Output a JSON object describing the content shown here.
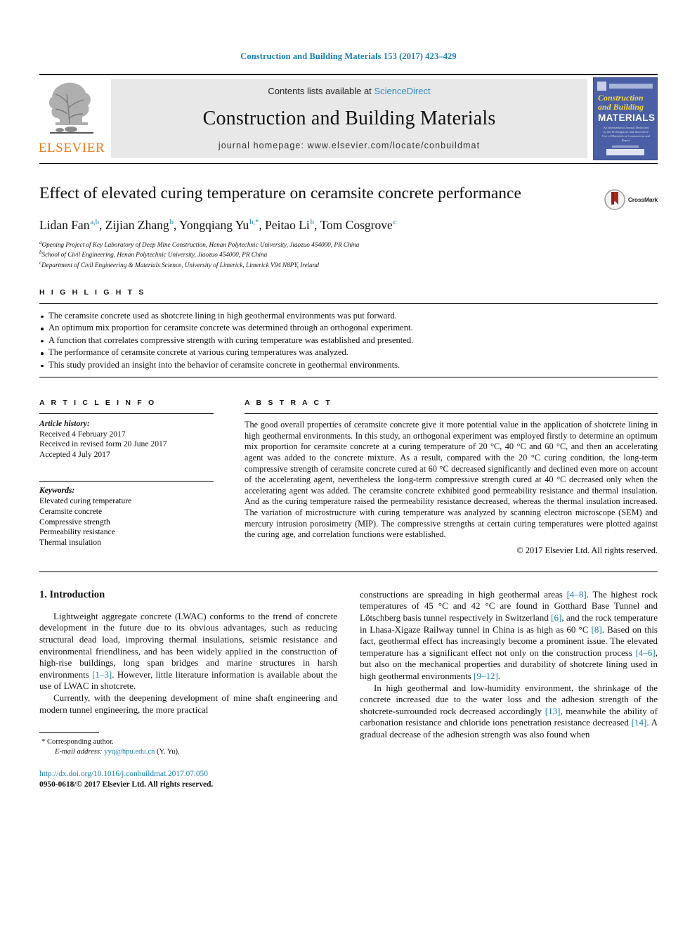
{
  "running_head": "Construction and Building Materials 153 (2017) 423–429",
  "masthead": {
    "publisher_name": "ELSEVIER",
    "contents_prefix": "Contents lists available at ",
    "contents_link": "ScienceDirect",
    "journal_name": "Construction and Building Materials",
    "homepage": "journal homepage: www.elsevier.com/locate/conbuildmat",
    "cover": {
      "line1": "Construction",
      "line2": "and Building",
      "line3": "MATERIALS",
      "blurb": "An International Journal Dedicated to the Investigation and Innovative Use of Materials in Construction and Repair"
    }
  },
  "article": {
    "title": "Effect of elevated curing temperature on ceramsite concrete performance",
    "crossmark_label": "CrossMark",
    "authors": [
      {
        "name": "Lidan Fan",
        "sup": "a,b"
      },
      {
        "name": "Zijian Zhang",
        "sup": "b"
      },
      {
        "name": "Yongqiang Yu",
        "sup": "b,*"
      },
      {
        "name": "Peitao Li",
        "sup": "b"
      },
      {
        "name": "Tom Cosgrove",
        "sup": "c"
      }
    ],
    "affiliations": [
      {
        "sup": "a",
        "text": "Opening Project of Key Laboratory of Deep Mine Construction, Henan Polytechnic University, Jiaozuo 454000, PR China"
      },
      {
        "sup": "b",
        "text": "School of Civil Engineering, Henan Polytechnic University, Jiaozuo 454000, PR China"
      },
      {
        "sup": "c",
        "text": "Department of Civil Engineering & Materials Science, University of Limerick, Limerick V94 N8PY, Ireland"
      }
    ]
  },
  "highlights": {
    "heading": "H I G H L I G H T S",
    "items": [
      "The ceramsite concrete used as shotcrete lining in high geothermal environments was put forward.",
      "An optimum mix proportion for ceramsite concrete was determined through an orthogonal experiment.",
      "A function that correlates compressive strength with curing temperature was established and presented.",
      "The performance of ceramsite concrete at various curing temperatures was analyzed.",
      "This study provided an insight into the behavior of ceramsite concrete in geothermal environments."
    ]
  },
  "article_info": {
    "heading": "A R T I C L E   I N F O",
    "history_label": "Article history:",
    "history": [
      "Received 4 February 2017",
      "Received in revised form 20 June 2017",
      "Accepted 4 July 2017"
    ],
    "keywords_label": "Keywords:",
    "keywords": [
      "Elevated curing temperature",
      "Ceramsite concrete",
      "Compressive strength",
      "Permeability resistance",
      "Thermal insulation"
    ]
  },
  "abstract": {
    "heading": "A B S T R A C T",
    "text": "The good overall properties of ceramsite concrete give it more potential value in the application of shotcrete lining in high geothermal environments. In this study, an orthogonal experiment was employed firstly to determine an optimum mix proportion for ceramsite concrete at a curing temperature of 20 °C, 40 °C and 60 °C, and then an accelerating agent was added to the concrete mixture. As a result, compared with the 20 °C curing condition, the long-term compressive strength of ceramsite concrete cured at 60 °C decreased significantly and declined even more on account of the accelerating agent, nevertheless the long-term compressive strength cured at 40 °C decreased only when the accelerating agent was added. The ceramsite concrete exhibited good permeability resistance and thermal insulation. And as the curing temperature raised the permeability resistance decreased, whereas the thermal insulation increased. The variation of microstructure with curing temperature was analyzed by scanning electron microscope (SEM) and mercury intrusion porosimetry (MIP). The compressive strengths at certain curing temperatures were plotted against the curing age, and correlation functions were established.",
    "copyright": "© 2017 Elsevier Ltd. All rights reserved."
  },
  "body": {
    "section_title": "1. Introduction",
    "left_paragraphs": [
      "Lightweight aggregate concrete (LWAC) conforms to the trend of concrete development in the future due to its obvious advantages, such as reducing structural dead load, improving thermal insulations, seismic resistance and environmental friendliness, and has been widely applied in the construction of high-rise buildings, long span bridges and marine structures in harsh environments [1–3]. However, little literature information is available about the use of LWAC in shotcrete.",
      "Currently, with the deepening development of mine shaft engineering and modern tunnel engineering, the more practical"
    ],
    "right_paragraphs": [
      "constructions are spreading in high geothermal areas [4–8]. The highest rock temperatures of 45 °C and 42 °C are found in Gotthard Base Tunnel and Lötschberg basis tunnel respectively in Switzerland [6], and the rock temperature in Lhasa-Xigaze Railway tunnel in China is as high as 60 °C [8]. Based on this fact, geothermal effect has increasingly become a prominent issue. The elevated temperature has a significant effect not only on the construction process [4–6], but also on the mechanical properties and durability of shotcrete lining used in high geothermal environments [9–12].",
      "In high geothermal and low-humidity environment, the shrinkage of the concrete increased due to the water loss and the adhesion strength of the shotcrete-surrounded rock decreased accordingly [13], meanwhile the ability of carbonation resistance and chloride ions penetration resistance decreased [14]. A gradual decrease of the adhesion strength was also found when"
    ]
  },
  "footnote": {
    "corresponding": "Corresponding author.",
    "email_label": "E-mail address:",
    "email": "yyq@hpu.edu.cn",
    "email_suffix": "(Y. Yu).",
    "doi": "http://dx.doi.org/10.1016/j.conbuildmat.2017.07.050",
    "issn": "0950-0618/© 2017 Elsevier Ltd. All rights reserved."
  },
  "colors": {
    "link": "#1a7eb5",
    "elsevier_orange": "#ef7c1a",
    "cover_blue": "#4a5fa5"
  }
}
